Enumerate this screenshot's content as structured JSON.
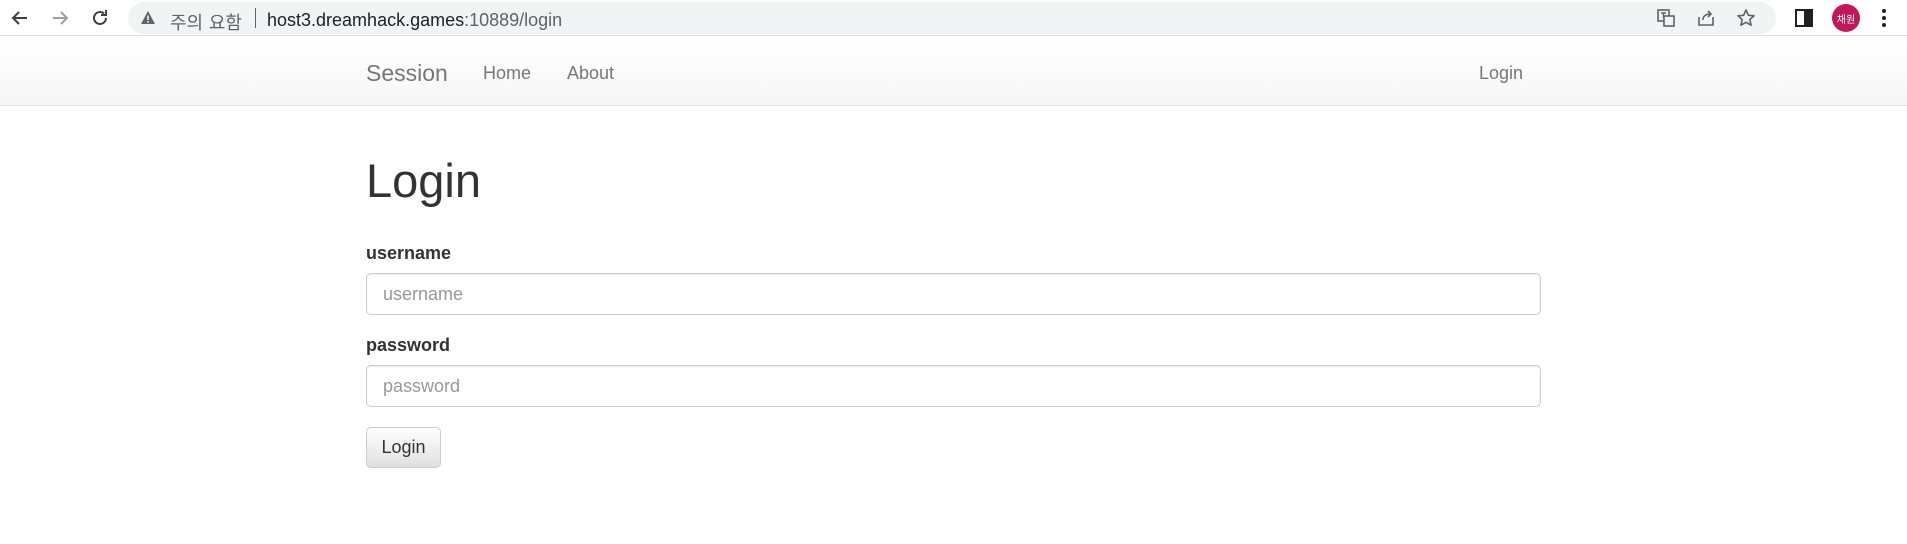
{
  "browser": {
    "security_label": "주의 요함",
    "url_host": "host3.dreamhack.games",
    "url_path": ":10889/login",
    "avatar_text": "채원",
    "avatar_color": "#c2185b"
  },
  "navbar": {
    "brand": "Session",
    "links": [
      "Home",
      "About"
    ],
    "right_link": "Login"
  },
  "page": {
    "title": "Login",
    "username_label": "username",
    "username_placeholder": "username",
    "password_label": "password",
    "password_placeholder": "password",
    "submit_label": "Login"
  },
  "icons": [
    "back-icon",
    "forward-icon",
    "reload-icon",
    "warning-icon",
    "translate-icon",
    "share-icon",
    "star-icon",
    "side-panel-icon",
    "more-icon"
  ]
}
